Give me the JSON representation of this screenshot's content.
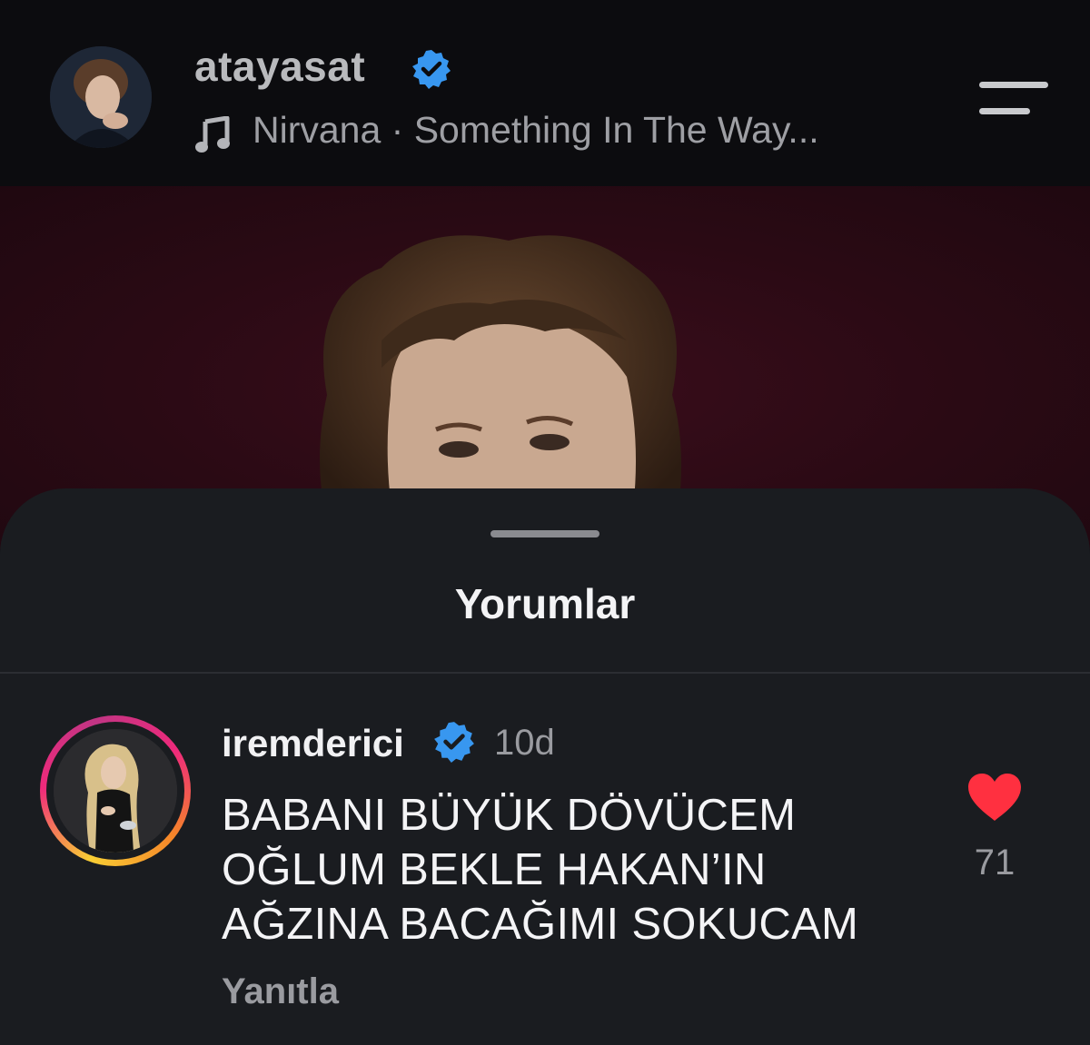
{
  "header": {
    "username": "atayasat",
    "music_icon": "music-note-icon",
    "music_text": "Nirvana · Something In The Way...",
    "menu_icon": "menu-icon"
  },
  "comments_sheet": {
    "title": "Yorumlar",
    "comments": [
      {
        "username": "iremderici",
        "verified": true,
        "time": "10d",
        "text_lines": [
          "BABANI BÜYÜK DÖVÜCEM",
          "OĞLUM BEKLE HAKAN’IN",
          "AĞZINA BACAĞIMI SOKUCAM"
        ],
        "reply_label": "Yanıtla",
        "like_icon": "heart-icon",
        "like_count": "71"
      }
    ]
  },
  "colors": {
    "verified_badge": "#3897f0",
    "heart": "#ff3040",
    "media_background": "#2a0a14",
    "sheet_background": "#1a1c20"
  }
}
